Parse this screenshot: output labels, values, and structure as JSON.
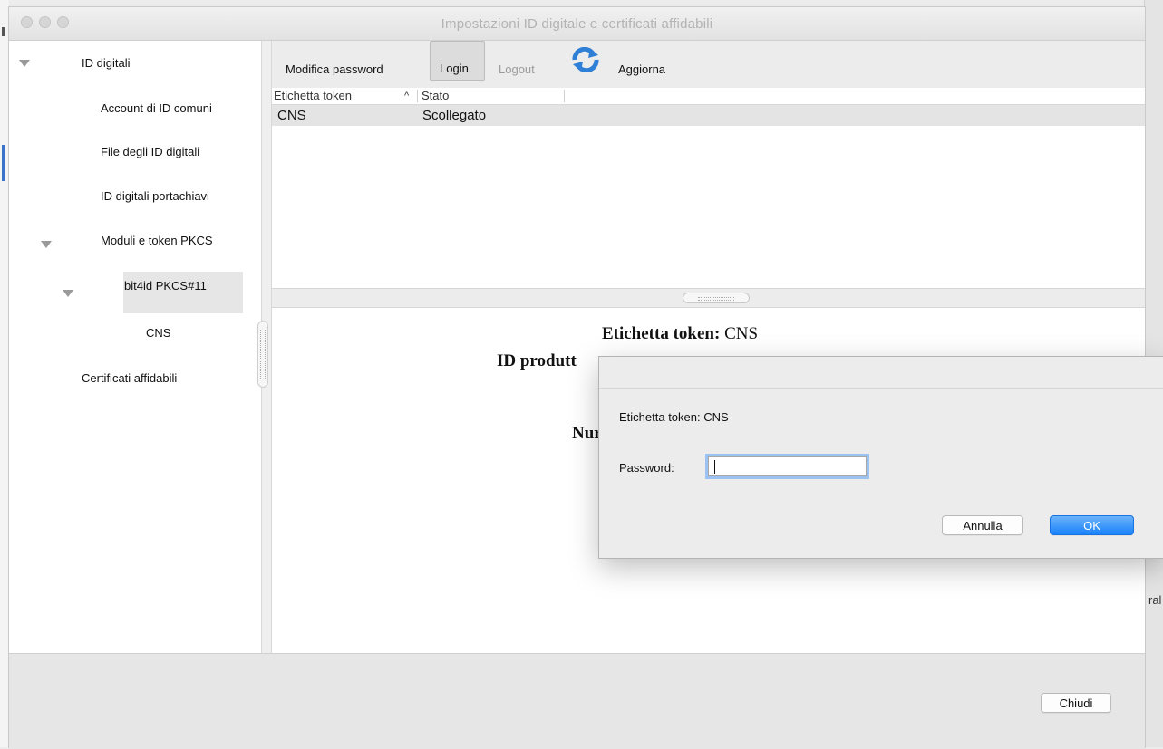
{
  "window": {
    "title": "Impostazioni ID digitale e certificati affidabili"
  },
  "sidebar": {
    "items": [
      {
        "label": "ID digitali"
      },
      {
        "label": "Account di ID comuni"
      },
      {
        "label": "File degli ID digitali"
      },
      {
        "label": "ID digitali portachiavi"
      },
      {
        "label": "Moduli e token PKCS"
      },
      {
        "label": "bit4id PKCS#11"
      },
      {
        "label": "CNS"
      },
      {
        "label": "Certificati affidabili"
      }
    ]
  },
  "toolbar": {
    "change_password": "Modifica password",
    "login": "Login",
    "logout": "Logout",
    "refresh": "Aggiorna"
  },
  "table": {
    "columns": [
      "Etichetta token",
      "Stato"
    ],
    "sort_indicator": "^",
    "rows": [
      {
        "label": "CNS",
        "status": "Scollegato"
      }
    ]
  },
  "detail": {
    "token_label_key": "Etichetta token:",
    "token_label_value": "CNS",
    "manufacturer_fragment": "ID produtt",
    "number_fragment": "Nur"
  },
  "footer": {
    "close": "Chiudi"
  },
  "dialog": {
    "token_label": "Etichetta token: CNS",
    "password_label": "Password:",
    "password_value": "",
    "cancel": "Annulla",
    "ok": "OK"
  },
  "background": {
    "right_fragment": "ral"
  }
}
